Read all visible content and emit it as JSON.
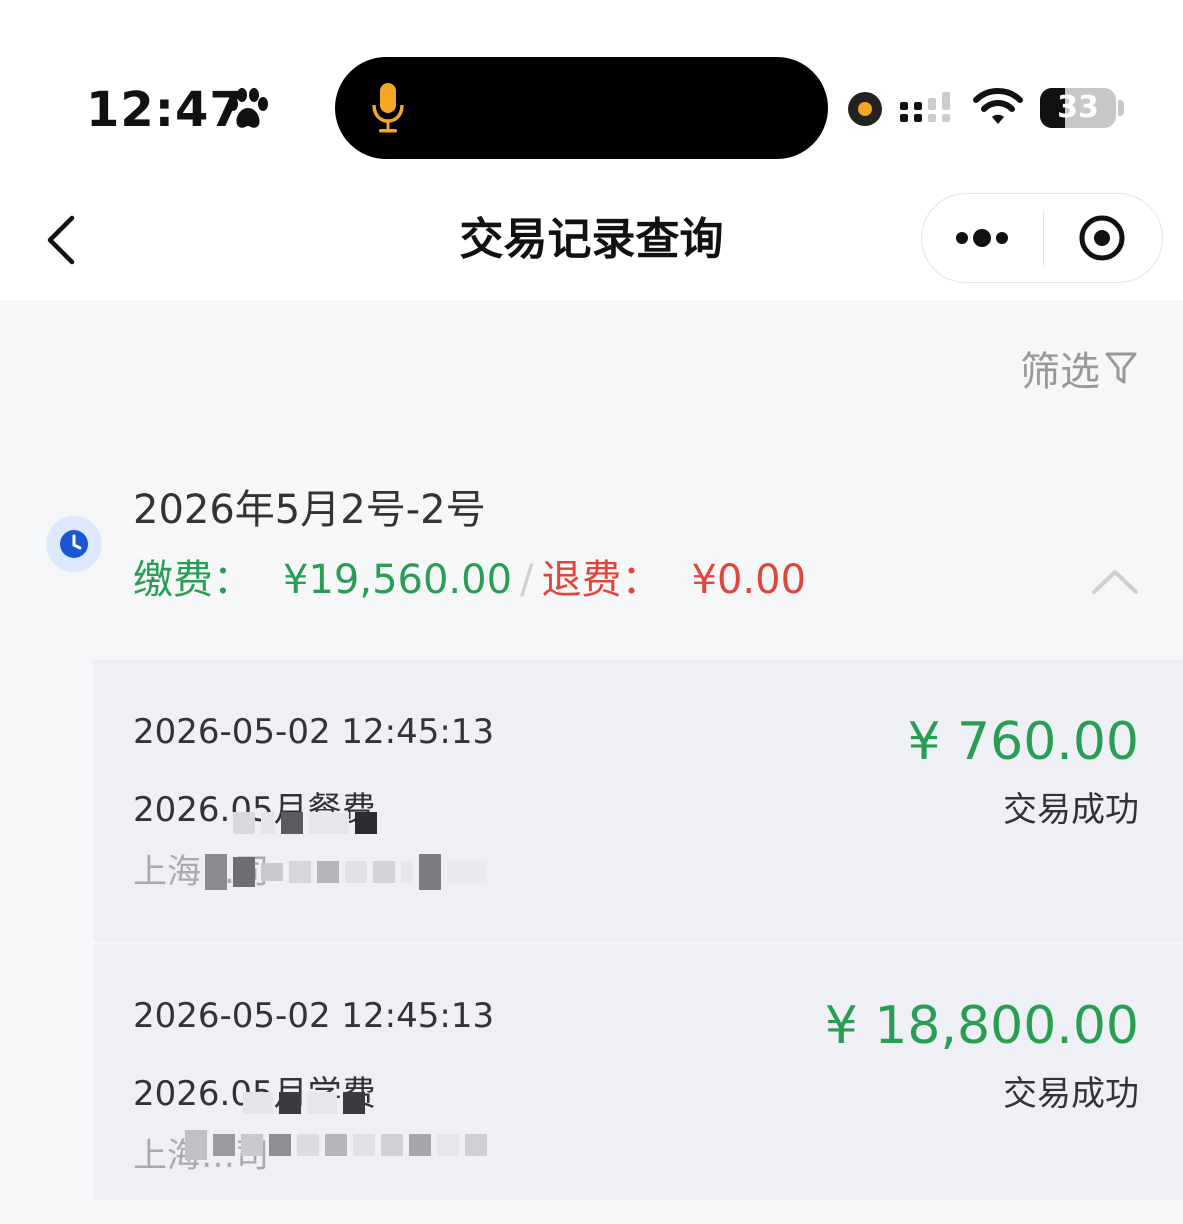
{
  "status_bar": {
    "time": "12:47",
    "battery": "33",
    "battery_level": 0.33
  },
  "nav": {
    "title": "交易记录查询"
  },
  "filter": {
    "label": "筛选"
  },
  "group": {
    "date_range": "2026年5月2号-2号",
    "pay_label": "缴费：",
    "pay_amount": "¥19,560.00",
    "separator": "/",
    "refund_label": "退费：",
    "refund_amount": "¥0.00"
  },
  "records": [
    {
      "time": "2026-05-02 12:45:13",
      "name": "2026.05月餐费",
      "org": "上海…司",
      "amount": "¥ 760.00",
      "status": "交易成功"
    },
    {
      "time": "2026-05-02 12:45:13",
      "name": "2026.05月学费",
      "org": "上海…司",
      "amount": "¥ 18,800.00",
      "status": "交易成功"
    }
  ],
  "colors": {
    "pay": "#2a9d55",
    "refund": "#e2453a",
    "accent_blue": "#1a56d6"
  }
}
